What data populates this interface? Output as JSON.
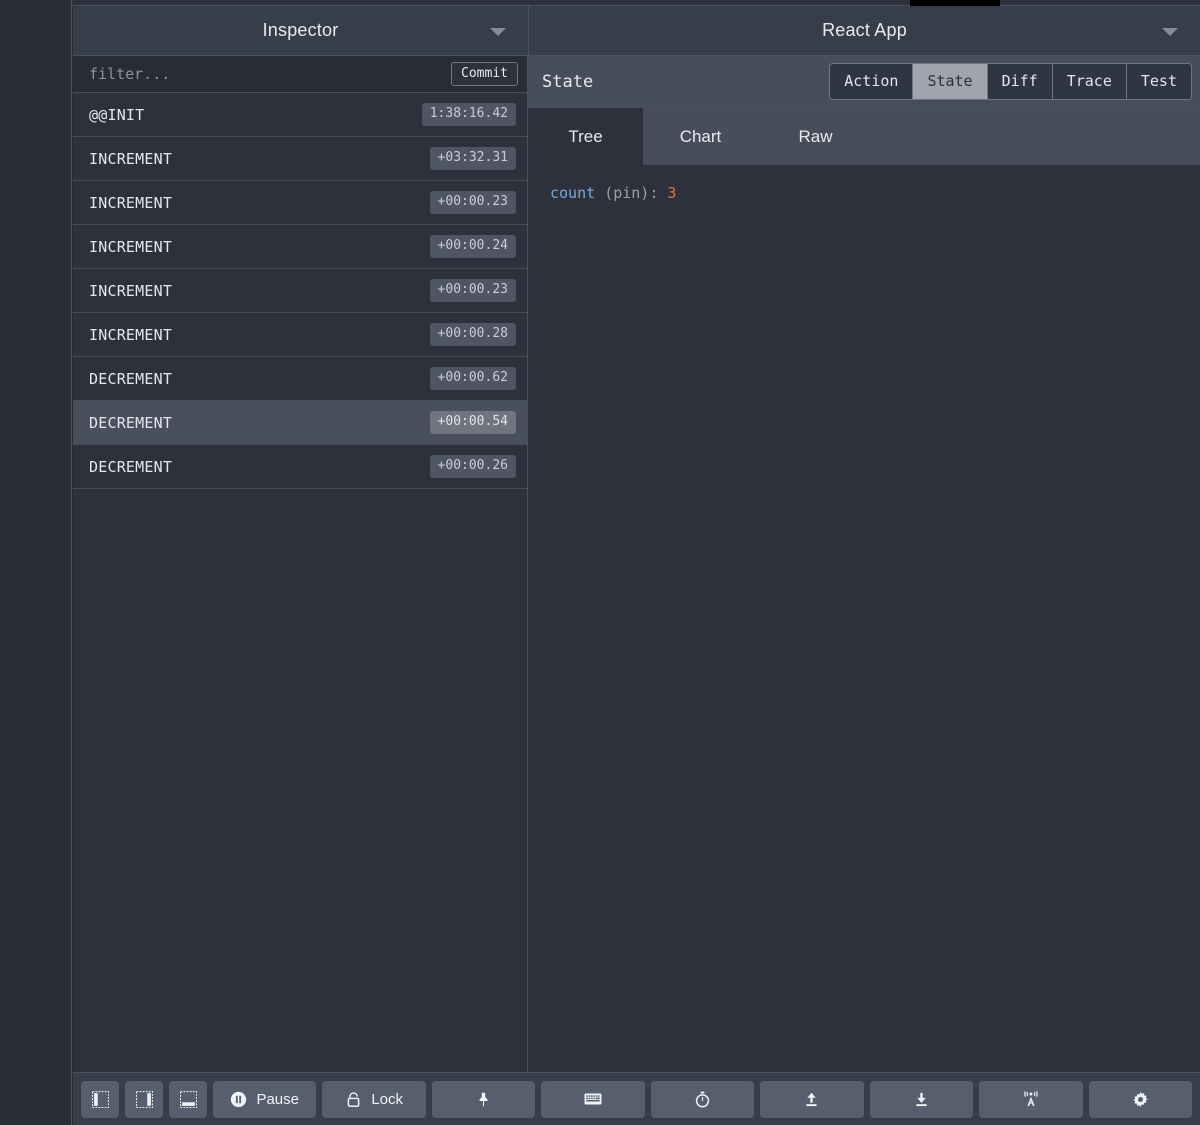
{
  "header": {
    "left_title": "Inspector",
    "right_title": "React App",
    "left_chevron_icon": "chevron-down-icon",
    "right_chevron_icon": "chevron-down-icon"
  },
  "filter": {
    "value": "",
    "placeholder": "filter...",
    "commit_label": "Commit"
  },
  "actions": [
    {
      "name": "@@INIT",
      "time": "1:38:16.42",
      "selected": false
    },
    {
      "name": "INCREMENT",
      "time": "+03:32.31",
      "selected": false
    },
    {
      "name": "INCREMENT",
      "time": "+00:00.23",
      "selected": false
    },
    {
      "name": "INCREMENT",
      "time": "+00:00.24",
      "selected": false
    },
    {
      "name": "INCREMENT",
      "time": "+00:00.23",
      "selected": false
    },
    {
      "name": "INCREMENT",
      "time": "+00:00.28",
      "selected": false
    },
    {
      "name": "DECREMENT",
      "time": "+00:00.62",
      "selected": false
    },
    {
      "name": "DECREMENT",
      "time": "+00:00.54",
      "selected": true
    },
    {
      "name": "DECREMENT",
      "time": "+00:00.26",
      "selected": false
    }
  ],
  "inspector": {
    "section_label": "State",
    "monitors": [
      {
        "label": "Action",
        "active": false
      },
      {
        "label": "State",
        "active": true
      },
      {
        "label": "Diff",
        "active": false
      },
      {
        "label": "Trace",
        "active": false
      },
      {
        "label": "Test",
        "active": false
      }
    ],
    "tabs": [
      {
        "label": "Tree",
        "active": true
      },
      {
        "label": "Chart",
        "active": false
      },
      {
        "label": "Raw",
        "active": false
      }
    ],
    "tree": {
      "key": "count",
      "meta": "(pin)",
      "separator": ":",
      "value": "3"
    }
  },
  "toolbar": {
    "buttons": [
      {
        "name": "dock-left-button",
        "icon": "dock-left-icon",
        "label": ""
      },
      {
        "name": "dock-right-button",
        "icon": "dock-right-icon",
        "label": ""
      },
      {
        "name": "dock-bottom-button",
        "icon": "dock-bottom-icon",
        "label": ""
      },
      {
        "name": "pause-button",
        "icon": "pause-circle-icon",
        "label": "Pause"
      },
      {
        "name": "lock-button",
        "icon": "lock-icon",
        "label": "Lock"
      },
      {
        "name": "pin-button",
        "icon": "pin-icon",
        "label": ""
      },
      {
        "name": "keyboard-button",
        "icon": "keyboard-icon",
        "label": ""
      },
      {
        "name": "timer-button",
        "icon": "stopwatch-icon",
        "label": ""
      },
      {
        "name": "import-button",
        "icon": "upload-icon",
        "label": ""
      },
      {
        "name": "export-button",
        "icon": "download-icon",
        "label": ""
      },
      {
        "name": "remote-button",
        "icon": "broadcast-icon",
        "label": ""
      },
      {
        "name": "settings-button",
        "icon": "gear-icon",
        "label": ""
      }
    ]
  },
  "colors": {
    "background": "#272c35",
    "panel": "#2c313c",
    "header": "#383d4a",
    "subbar": "#474d5b",
    "selected_row": "#4a4f5e",
    "accent_active": "#a0a4ad",
    "key_color": "#78a8d8",
    "number_color": "#e8704a"
  }
}
